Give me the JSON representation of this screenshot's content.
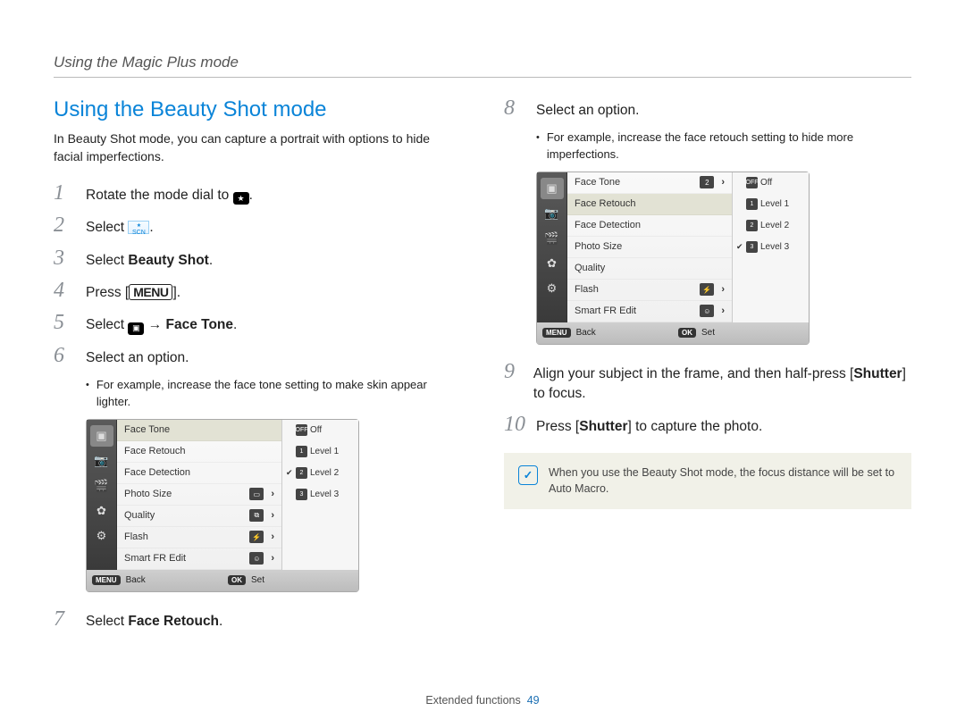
{
  "header": "Using the Magic Plus mode",
  "title": "Using the Beauty Shot mode",
  "intro": "In Beauty Shot mode, you can capture a portrait with options to hide facial imperfections.",
  "steps_left": {
    "s1_pre": "Rotate the mode dial to ",
    "s1_post": ".",
    "s2_pre": "Select ",
    "s2_post": ".",
    "s3_pre": "Select ",
    "s3_bold": "Beauty Shot",
    "s3_post": ".",
    "s4_pre": "Press [",
    "s4_menu": "MENU",
    "s4_post": "].",
    "s5_pre": "Select ",
    "s5_arrow": " → ",
    "s5_bold": "Face Tone",
    "s5_post": ".",
    "s6": "Select an option.",
    "s6_sub": "For example, increase the face tone setting to make skin appear lighter.",
    "s7_pre": "Select ",
    "s7_bold": "Face Retouch",
    "s7_post": "."
  },
  "steps_right": {
    "s8": "Select an option.",
    "s8_sub": "For example, increase the face retouch setting to hide more imperfections.",
    "s9_pre": "Align your subject in the frame, and then half-press [",
    "s9_bold": "Shutter",
    "s9_post": "] to focus.",
    "s10_pre": "Press [",
    "s10_bold": "Shutter",
    "s10_post": "] to capture the photo."
  },
  "note": "When you use the Beauty Shot mode, the focus distance will be set to Auto Macro.",
  "cam1": {
    "rows": [
      "Face Tone",
      "Face Retouch",
      "Face Detection",
      "Photo Size",
      "Quality",
      "Flash",
      "Smart FR Edit"
    ],
    "highlight_index": 0,
    "options": [
      "Off",
      "Level 1",
      "Level 2",
      "Level 3"
    ],
    "selected_option_index": 2,
    "back": "Back",
    "set": "Set"
  },
  "cam2": {
    "rows": [
      "Face Tone",
      "Face Retouch",
      "Face Detection",
      "Photo Size",
      "Quality",
      "Flash",
      "Smart FR Edit"
    ],
    "highlight_index": 1,
    "options": [
      "Off",
      "Level 1",
      "Level 2",
      "Level 3"
    ],
    "selected_option_index": 3,
    "back": "Back",
    "set": "Set"
  },
  "footer": {
    "section": "Extended functions",
    "page": "49"
  }
}
